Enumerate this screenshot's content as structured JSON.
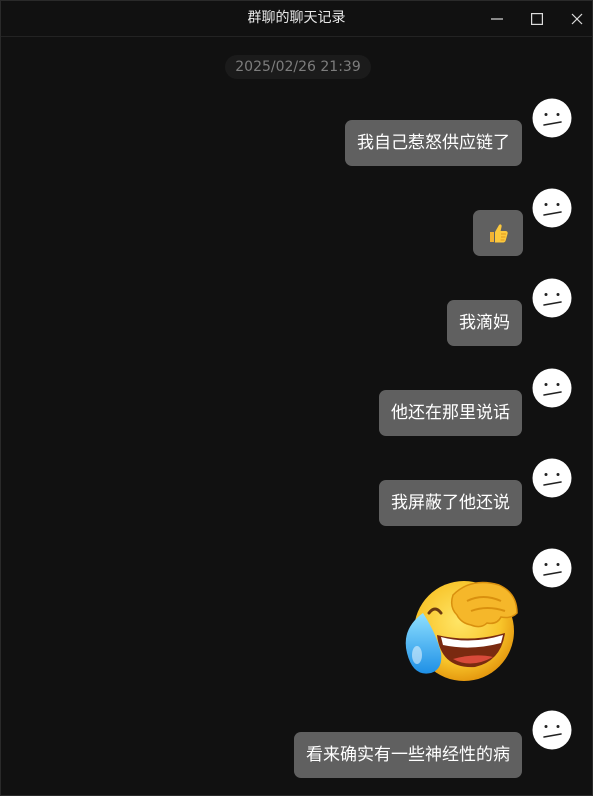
{
  "window": {
    "title": "群聊的聊天记录"
  },
  "timestamp": "2025/02/26 21:39",
  "messages": [
    {
      "type": "text",
      "text": "我自己惹怒供应链了"
    },
    {
      "type": "emoji",
      "icon": "thumbs-up-icon"
    },
    {
      "type": "text",
      "text": "我滴妈"
    },
    {
      "type": "text",
      "text": "他还在那里说话"
    },
    {
      "type": "text",
      "text": "我屏蔽了他还说"
    },
    {
      "type": "sticker",
      "icon": "laughing-crying-facepalm-sticker"
    },
    {
      "type": "text",
      "text": "看来确实有一些神经性的病"
    }
  ],
  "colors": {
    "background": "#111111",
    "bubble": "#606060",
    "bubble_text": "#ffffff",
    "timestamp_text": "#7d7d7d"
  }
}
